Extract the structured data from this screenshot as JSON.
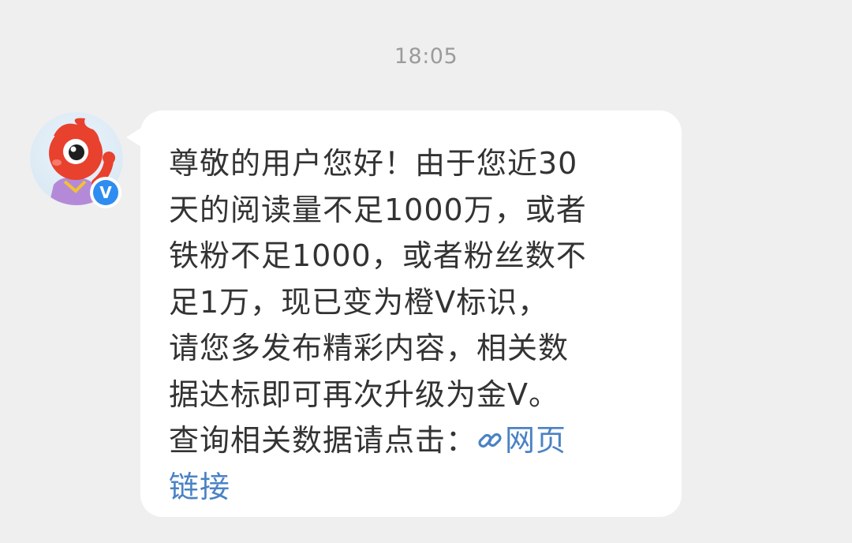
{
  "chat": {
    "timestamp": "18:05"
  },
  "sender": {
    "avatar_icon": "weibo-mascot-avatar",
    "badge_icon": "verified-v-badge",
    "badge_text": "V",
    "badge_color": "#2f8cf0"
  },
  "message": {
    "lines": [
      "尊敬的用户您好！由于您近30",
      "天的阅读量不足1000万，或者",
      "铁粉不足1000，或者粉丝数不",
      "足1万，现已变为橙V标识，",
      "请您多发布精彩内容，相关数",
      "据达标即可再次升级为金V。"
    ],
    "link_prefix": "查询相关数据请点击：",
    "link_text_1": "网页",
    "link_text_2": "链接",
    "link_icon": "link-icon",
    "link_color": "#4a82c4"
  }
}
